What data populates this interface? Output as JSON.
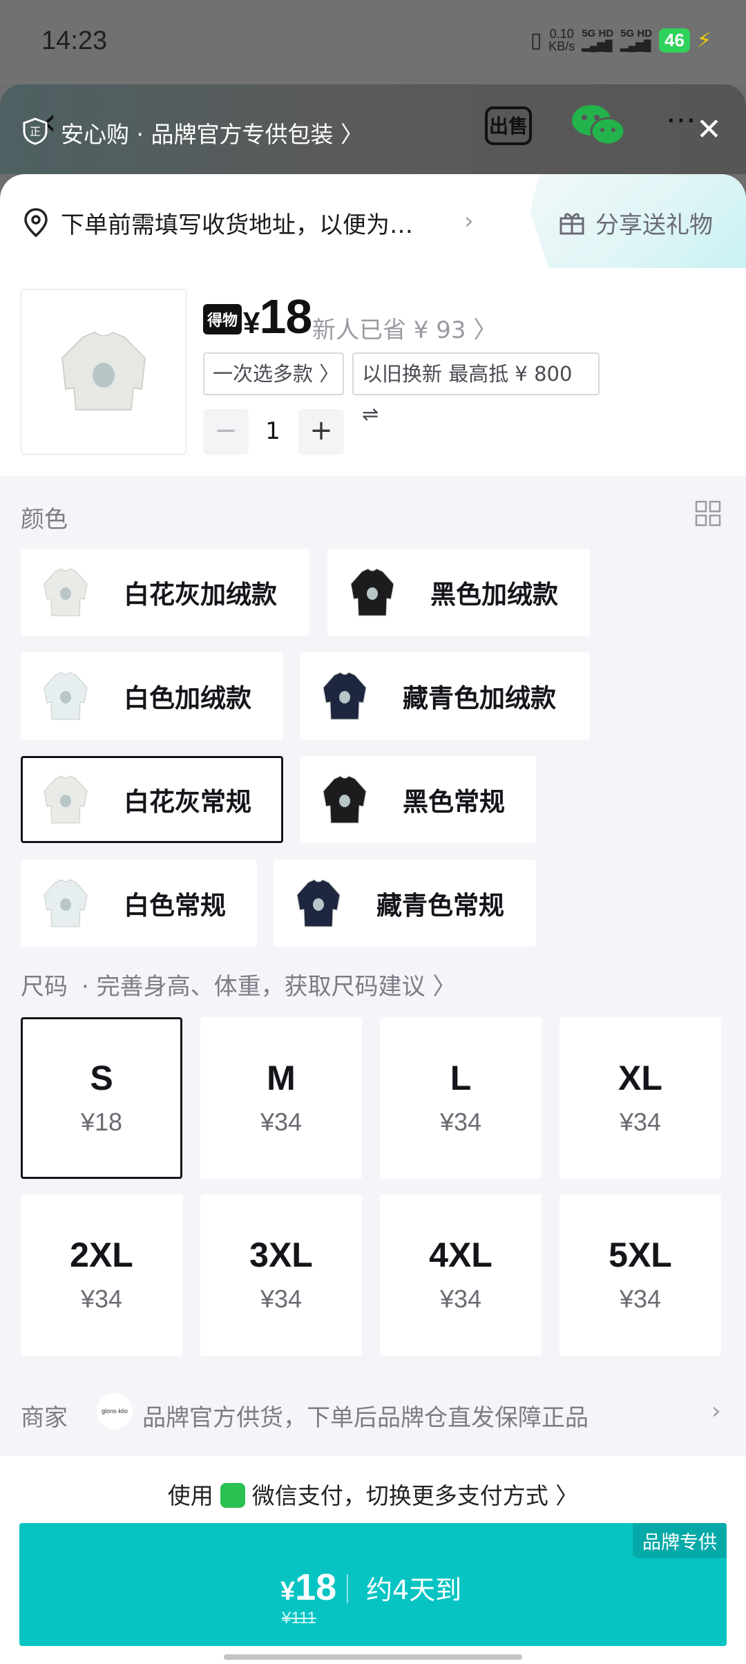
{
  "status_bar": {
    "time": "14:23",
    "speed_value": "0.10",
    "speed_unit": "KB/s",
    "net1": "5G HD",
    "net2": "5G HD",
    "battery": "46"
  },
  "header": {
    "title": "安心购 · 品牌官方专供包装 〉",
    "sell_label": "出售"
  },
  "address": {
    "text": "下单前需填写收货地址，以便为…",
    "gift_label": "分享送礼物"
  },
  "product": {
    "badge": "得物",
    "currency": "¥",
    "price": "18",
    "saved": "新人已省 ¥ 93 〉",
    "tag_multi": "一次选多款 〉",
    "tag_tradein": "以旧换新 最高抵 ¥ 800 ⇌",
    "quantity": "1",
    "minus": "−",
    "plus": "+"
  },
  "color_section": {
    "label": "颜色",
    "options": [
      {
        "label": "白花灰加绒款",
        "swatch": "#e9ebe6",
        "selected": false
      },
      {
        "label": "黑色加绒款",
        "swatch": "#1c1c1e",
        "selected": false
      },
      {
        "label": "白色加绒款",
        "swatch": "#e6eef0",
        "selected": false
      },
      {
        "label": "藏青色加绒款",
        "swatch": "#1f2740",
        "selected": false
      },
      {
        "label": "白花灰常规",
        "swatch": "#e9ebe6",
        "selected": true
      },
      {
        "label": "黑色常规",
        "swatch": "#1c1c1e",
        "selected": false
      },
      {
        "label": "白色常规",
        "swatch": "#e6eef0",
        "selected": false
      },
      {
        "label": "藏青色常规",
        "swatch": "#1f2740",
        "selected": false
      }
    ]
  },
  "size_section": {
    "label": "尺码",
    "hint": "·  完善身高、体重，获取尺码建议 〉",
    "options": [
      {
        "size": "S",
        "price": "¥18",
        "selected": true
      },
      {
        "size": "M",
        "price": "¥34",
        "selected": false
      },
      {
        "size": "L",
        "price": "¥34",
        "selected": false
      },
      {
        "size": "XL",
        "price": "¥34",
        "selected": false
      },
      {
        "size": "2XL",
        "price": "¥34",
        "selected": false
      },
      {
        "size": "3XL",
        "price": "¥34",
        "selected": false
      },
      {
        "size": "4XL",
        "price": "¥34",
        "selected": false
      },
      {
        "size": "5XL",
        "price": "¥34",
        "selected": false
      }
    ]
  },
  "seller": {
    "label": "商家",
    "logo_text": "glons·klio",
    "text": "品牌官方供货，下单后品牌仓直发保障正品"
  },
  "payment": {
    "prefix": "使用",
    "text": "微信支付，切换更多支付方式 〉"
  },
  "buy_button": {
    "badge": "品牌专供",
    "currency": "¥",
    "price": "18",
    "original_price": "¥111",
    "eta": "约4天到"
  },
  "colors": {
    "accent": "#07c4c3",
    "selected_border": "#14151a",
    "options_bg": "#f5f5f9"
  }
}
